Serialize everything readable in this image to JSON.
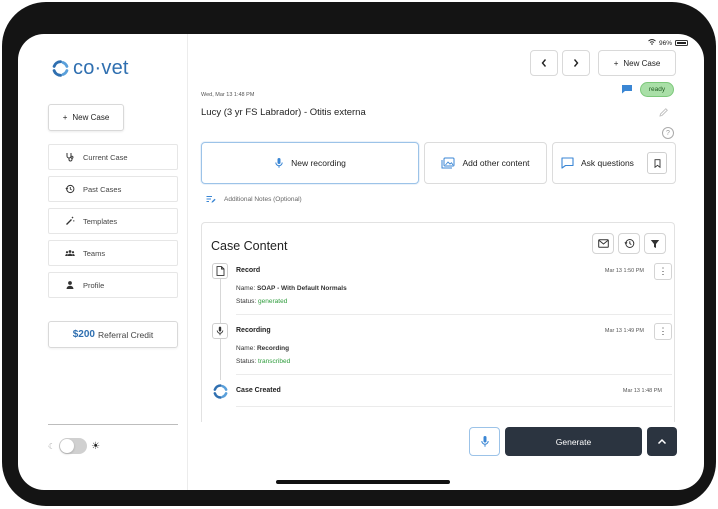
{
  "status_bar": {
    "battery": "96%"
  },
  "brand": {
    "name": "co·vet",
    "color": "#2f6fb0"
  },
  "sidebar": {
    "new_case": "New Case",
    "items": [
      {
        "label": "Current Case",
        "icon": "stethoscope-icon"
      },
      {
        "label": "Past Cases",
        "icon": "history-icon"
      },
      {
        "label": "Templates",
        "icon": "magic-wand-icon"
      },
      {
        "label": "Teams",
        "icon": "team-icon"
      },
      {
        "label": "Profile",
        "icon": "person-icon"
      }
    ],
    "referral_amount": "$200",
    "referral_label": "Referral Credit"
  },
  "header": {
    "prev": "‹",
    "next": "›",
    "new_case": "New Case",
    "date": "Wed, Mar 13 1:48 PM",
    "status_badge": "ready",
    "case_title": "Lucy (3 yr FS Labrador) - Otitis externa"
  },
  "actions": {
    "new_recording": "New recording",
    "add_content": "Add other content",
    "ask_questions": "Ask questions"
  },
  "additional_notes": "Additional Notes (Optional)",
  "case_content": {
    "title": "Case Content",
    "entries": [
      {
        "title": "Record",
        "time": "Mar 13 1:50 PM",
        "name_label": "Name:",
        "name": "SOAP - With Default Normals",
        "status_label": "Status:",
        "status": "generated"
      },
      {
        "title": "Recording",
        "time": "Mar 13 1:49 PM",
        "name_label": "Name:",
        "name": "Recording",
        "status_label": "Status:",
        "status": "transcribed"
      },
      {
        "title": "Case Created",
        "time": "Mar 13 1:48 PM"
      }
    ]
  },
  "footer": {
    "generate": "Generate"
  },
  "colors": {
    "accent": "#2f6fb0",
    "ready_bg": "#a9dfa7",
    "status_green": "#2e9c3c",
    "dark_button": "#2b3440"
  }
}
